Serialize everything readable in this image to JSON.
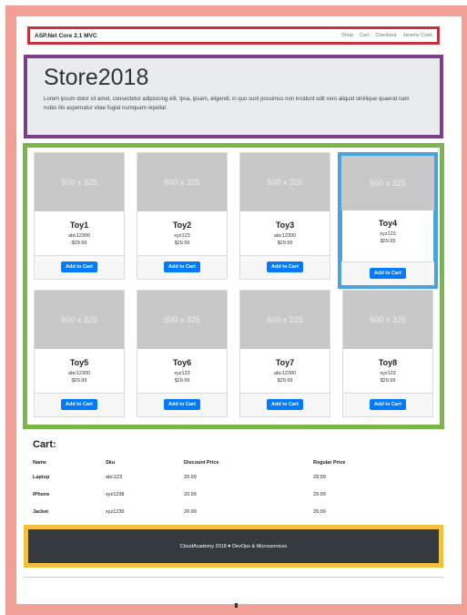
{
  "navbar": {
    "brand": "ASP.Net Core 2.1 MVC",
    "links": [
      "Shop",
      "Cart",
      "Checkout",
      "Jeremy Cook"
    ]
  },
  "jumbotron": {
    "title": "Store2018",
    "text": "Lorem ipsum dolor sit amet, consectetur adipisicing elit. Ipsa, ipsam, eligendi, in quo sunt possimus non incidunt odit vero aliquid similique quaerat nam nobis illo aspernatur vitae fugiat numquam repellat."
  },
  "products": [
    {
      "image": "500 x 325",
      "name": "Toy1",
      "sku": "abc12300",
      "price": "$29.99",
      "button": "Add to Cart"
    },
    {
      "image": "500 x 325",
      "name": "Toy2",
      "sku": "xyz123",
      "price": "$29.99",
      "button": "Add to Cart"
    },
    {
      "image": "500 x 325",
      "name": "Toy3",
      "sku": "abc12300",
      "price": "$29.99",
      "button": "Add to Cart"
    },
    {
      "image": "500 x 325",
      "name": "Toy4",
      "sku": "xyz123",
      "price": "$29.99",
      "button": "Add to Cart"
    },
    {
      "image": "500 x 325",
      "name": "Toy5",
      "sku": "abc12300",
      "price": "$29.99",
      "button": "Add to Cart"
    },
    {
      "image": "500 x 325",
      "name": "Toy6",
      "sku": "xyz123",
      "price": "$29.99",
      "button": "Add to Cart"
    },
    {
      "image": "500 x 325",
      "name": "Toy7",
      "sku": "abc12300",
      "price": "$29.99",
      "button": "Add to Cart"
    },
    {
      "image": "500 x 325",
      "name": "Toy8",
      "sku": "xyz123",
      "price": "$29.99",
      "button": "Add to Cart"
    }
  ],
  "cart": {
    "title": "Cart:",
    "columns": [
      "Name",
      "Sku",
      "Discount Price",
      "Regular Price"
    ],
    "rows": [
      [
        "Laptop",
        "abc123",
        "20.99",
        "29.99"
      ],
      [
        "iPhone",
        "xyz1238",
        "20.99",
        "29.99"
      ],
      [
        "Jacket",
        "xyz1239",
        "20.99",
        "29.99"
      ]
    ]
  },
  "footer": {
    "text": "CloudAcademy 2018 ♥ DevOps & Microservices"
  },
  "colors": {
    "outer_frame": "#f0a096",
    "navbar_highlight": "#c8323c",
    "jumbotron_highlight": "#7b3f8c",
    "products_highlight": "#7ab648",
    "card_highlight": "#4aa3dc",
    "footer_highlight": "#f2c03c",
    "button": "#007bff",
    "footer_bg": "#343a40"
  }
}
